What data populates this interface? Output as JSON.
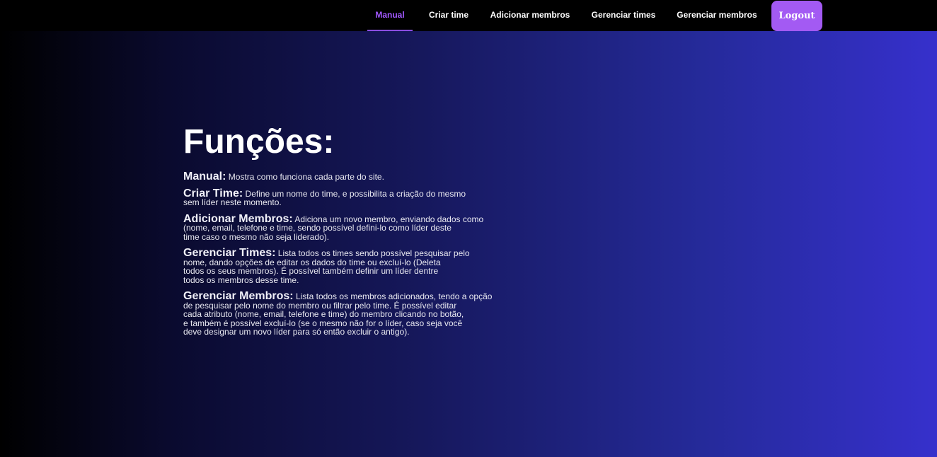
{
  "nav": {
    "items": [
      {
        "label": "Manual",
        "active": true
      },
      {
        "label": "Criar time",
        "active": false
      },
      {
        "label": "Adicionar membros",
        "active": false
      },
      {
        "label": "Gerenciar times",
        "active": false
      },
      {
        "label": "Gerenciar membros",
        "active": false
      }
    ],
    "logout_label": "Logout",
    "active_color": "#a259ff",
    "logout_color": "#a35af3"
  },
  "main": {
    "title": "Funções:",
    "sections": [
      {
        "label": "Manual:",
        "lines": [
          " Mostra como funciona cada parte do site."
        ]
      },
      {
        "label": "Criar Time:",
        "lines": [
          " Define um nome do time, e possibilita a criação do mesmo",
          "sem líder neste momento."
        ]
      },
      {
        "label": "Adicionar Membros:",
        "lines": [
          " Adiciona um novo membro, enviando dados como",
          "(nome, email, telefone e time, sendo possível defini-lo como líder deste",
          "time caso o mesmo não seja liderado)."
        ]
      },
      {
        "label": "Gerenciar Times:",
        "lines": [
          " Lista todos os times sendo possível pesquisar pelo",
          "nome, dando opções de editar os dados do time ou excluí-lo (Deleta",
          "todos os seus membros). É possível também definir um líder dentre",
          "todos os membros desse time."
        ]
      },
      {
        "label": "Gerenciar Membros:",
        "lines": [
          " Lista todos os membros adicionados, tendo a opção",
          "de pesquisar pelo nome do membro ou filtrar pelo time. É possível editar",
          "cada atributo (nome, email, telefone e time) do membro clicando no botão,",
          "e também é possível excluí-lo (se o mesmo não for o líder, caso seja você",
          "deve designar um novo líder para só então excluir o antigo)."
        ]
      }
    ]
  }
}
